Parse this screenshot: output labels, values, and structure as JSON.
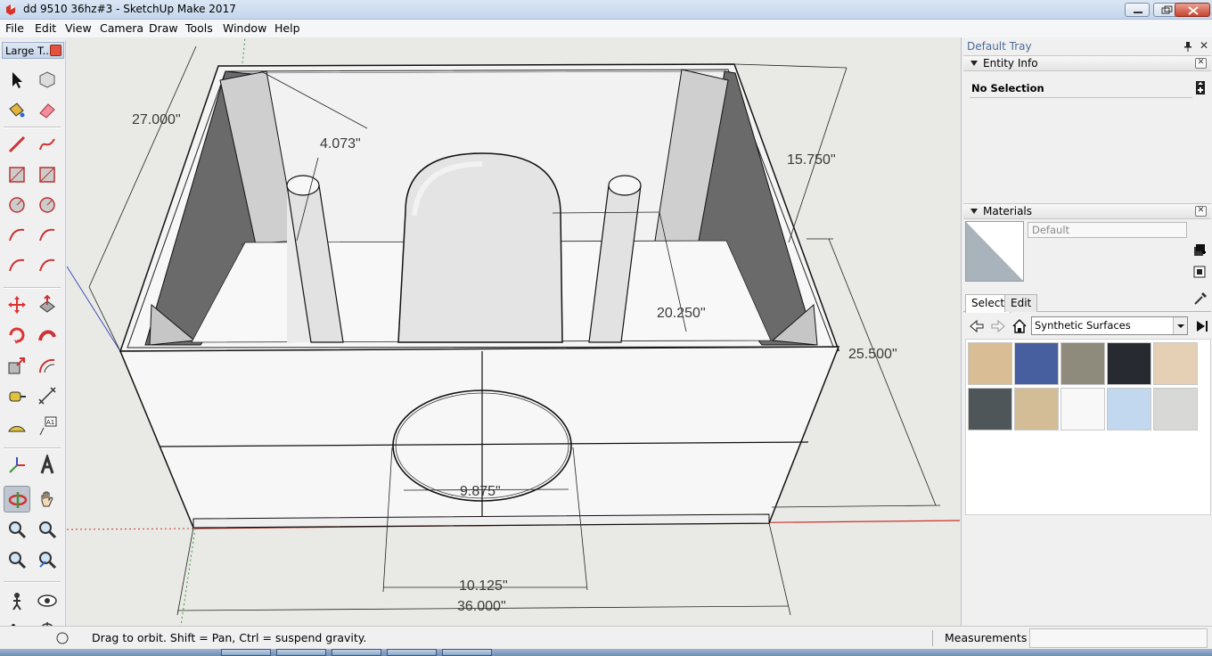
{
  "window": {
    "title": "dd 9510 36hz#3 - SketchUp Make 2017"
  },
  "menu": [
    "File",
    "Edit",
    "View",
    "Camera",
    "Draw",
    "Tools",
    "Window",
    "Help"
  ],
  "toolbar": {
    "title": "Large T...",
    "tools": [
      {
        "name": "select-tool-icon"
      },
      {
        "name": "component-tool-icon"
      },
      {
        "name": "paint-bucket-tool-icon"
      },
      {
        "name": "eraser-tool-icon"
      },
      {
        "name": "line-tool-icon"
      },
      {
        "name": "freehand-tool-icon"
      },
      {
        "name": "rectangle-tool-icon"
      },
      {
        "name": "rotated-rectangle-tool-icon"
      },
      {
        "name": "circle-tool-icon"
      },
      {
        "name": "polygon-tool-icon"
      },
      {
        "name": "arc-tool-icon"
      },
      {
        "name": "two-point-arc-tool-icon"
      },
      {
        "name": "three-point-arc-tool-icon"
      },
      {
        "name": "pie-tool-icon"
      },
      {
        "name": "move-tool-icon"
      },
      {
        "name": "push-pull-tool-icon"
      },
      {
        "name": "rotate-tool-icon"
      },
      {
        "name": "follow-me-tool-icon"
      },
      {
        "name": "scale-tool-icon"
      },
      {
        "name": "offset-tool-icon"
      },
      {
        "name": "tape-measure-tool-icon"
      },
      {
        "name": "dimension-tool-icon"
      },
      {
        "name": "protractor-tool-icon"
      },
      {
        "name": "text-tool-icon"
      },
      {
        "name": "axes-tool-icon"
      },
      {
        "name": "3d-text-tool-icon"
      },
      {
        "name": "orbit-tool-icon"
      },
      {
        "name": "pan-tool-icon"
      },
      {
        "name": "zoom-tool-icon"
      },
      {
        "name": "zoom-window-tool-icon"
      },
      {
        "name": "zoom-extents-tool-icon"
      },
      {
        "name": "previous-view-tool-icon"
      },
      {
        "name": "position-camera-tool-icon"
      },
      {
        "name": "look-around-tool-icon"
      },
      {
        "name": "walk-tool-icon"
      },
      {
        "name": "section-plane-tool-icon"
      }
    ],
    "text_tool_glyph": "A1"
  },
  "dimensions": {
    "height_front": "27.000\"",
    "brace": "4.073\"",
    "depth_top": "15.750\"",
    "inner": "20.250\"",
    "height_right": "25.500\"",
    "port_inner": "9.875\"",
    "port_outer": "10.125\"",
    "width": "36.000\""
  },
  "tray": {
    "title": "Default Tray",
    "close": "✕",
    "entity_info": {
      "header": "Entity Info",
      "no_selection": "No Selection"
    },
    "materials": {
      "header": "Materials",
      "name_value": "Default",
      "tabs": [
        "Select",
        "Edit"
      ],
      "library": "Synthetic Surfaces",
      "swatches": [
        "#d9bd95",
        "#475f9e",
        "#8e8a7c",
        "#272a30",
        "#e5cfb5",
        "#4e565a",
        "#d2bd97",
        "#f8f8f8",
        "#c2d8ee",
        "#d8d8d6"
      ]
    }
  },
  "status": {
    "hint": "Drag to orbit. Shift = Pan, Ctrl = suspend gravity.",
    "measurements_label": "Measurements",
    "measurements_value": ""
  },
  "colors": {
    "accent": "#4a6c98",
    "axis_red": "#c8332a",
    "axis_blue": "#3b4dc0",
    "axis_green": "#3a9a3a"
  }
}
